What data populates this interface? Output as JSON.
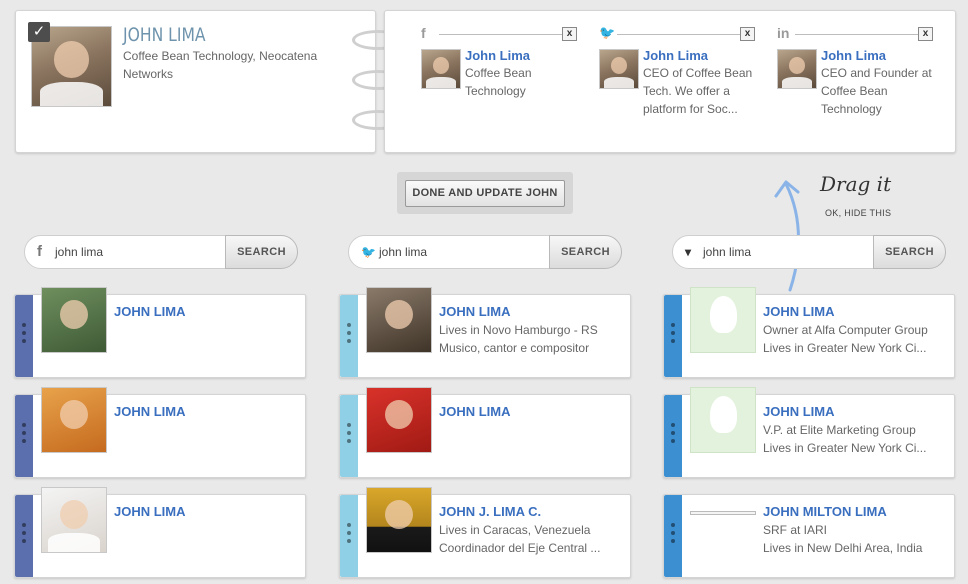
{
  "profile": {
    "name": "JOHN LIMA",
    "company": "Coffee Bean Technology, Neocatena Networks",
    "check_glyph": "✓"
  },
  "social": [
    {
      "network": "f",
      "name": "John Lima",
      "desc": "Coffee Bean Technology",
      "close": "x",
      "icon": "facebook-icon"
    },
    {
      "network": "🐦",
      "name": "John Lima",
      "desc": "CEO of Coffee Bean Tech. We offer a platform for Soc...",
      "close": "x",
      "icon": "twitter-icon"
    },
    {
      "network": "in",
      "name": "John Lima",
      "desc": "CEO and Founder at Coffee Bean Technology",
      "close": "x",
      "icon": "linkedin-icon"
    }
  ],
  "done_button": "DONE AND UPDATE JOHN",
  "drag_hint": {
    "text": "Drag it",
    "hide": "OK, HIDE THIS"
  },
  "searches": [
    {
      "icon_glyph": "f",
      "icon": "facebook-icon",
      "value": "john lima",
      "button": "SEARCH"
    },
    {
      "icon_glyph": "🐦",
      "icon": "twitter-icon",
      "value": "john lima",
      "button": "SEARCH"
    },
    {
      "icon_glyph": "▾",
      "icon": "dropdown-icon",
      "value": "john lima",
      "button": "SEARCH"
    }
  ],
  "colors": {
    "facebook_handle": "#5b6fae",
    "twitter_handle": "#8fd0e6",
    "linkedin_handle": "#3c8fd1",
    "name_blue": "#3a6fbf"
  },
  "results": {
    "facebook": [
      {
        "name": "JOHN LIMA",
        "line1": "",
        "line2": ""
      },
      {
        "name": "JOHN LIMA",
        "line1": "",
        "line2": ""
      },
      {
        "name": "JOHN LIMA",
        "line1": "",
        "line2": ""
      }
    ],
    "twitter": [
      {
        "name": "JOHN LIMA",
        "line1": "Lives in Novo Hamburgo - RS",
        "line2": "Musico, cantor e compositor"
      },
      {
        "name": "JOHN LIMA",
        "line1": "",
        "line2": ""
      },
      {
        "name": "JOHN J. LIMA C.",
        "line1": "Lives in Caracas, Venezuela",
        "line2": "Coordinador del Eje Central ..."
      }
    ],
    "linkedin": [
      {
        "name": "JOHN LIMA",
        "line1": "Owner at Alfa Computer Group",
        "line2": "Lives in Greater New York Ci..."
      },
      {
        "name": "JOHN LIMA",
        "line1": "V.P. at Elite Marketing Group",
        "line2": "Lives in Greater New York Ci..."
      },
      {
        "name": "JOHN MILTON LIMA",
        "line1": "SRF at IARI",
        "line2": "Lives in New Delhi Area, India"
      }
    ]
  }
}
